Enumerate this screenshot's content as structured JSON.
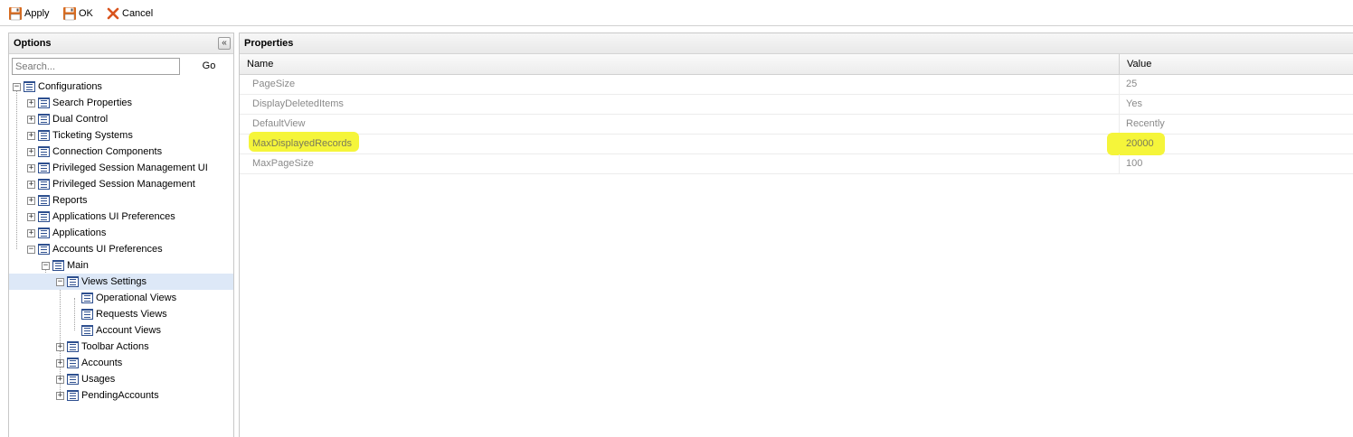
{
  "toolbar": {
    "apply_label": "Apply",
    "ok_label": "OK",
    "cancel_label": "Cancel"
  },
  "options_panel": {
    "title": "Options",
    "collapse_glyph": "«",
    "search_placeholder": "Search...",
    "go_label": "Go",
    "tree": [
      {
        "label": "Configurations",
        "expander": "−"
      },
      {
        "label": "Search Properties",
        "expander": "+"
      },
      {
        "label": "Dual Control",
        "expander": "+"
      },
      {
        "label": "Ticketing Systems",
        "expander": "+"
      },
      {
        "label": "Connection Components",
        "expander": "+"
      },
      {
        "label": "Privileged Session Management UI",
        "expander": "+"
      },
      {
        "label": "Privileged Session Management",
        "expander": "+"
      },
      {
        "label": "Reports",
        "expander": "+"
      },
      {
        "label": "Applications UI Preferences",
        "expander": "+"
      },
      {
        "label": "Applications",
        "expander": "+"
      },
      {
        "label": "Accounts UI Preferences",
        "expander": "−"
      },
      {
        "label": "Main",
        "expander": "−"
      },
      {
        "label": "Views Settings",
        "expander": "−",
        "selected": true
      },
      {
        "label": "Operational Views",
        "expander": ""
      },
      {
        "label": "Requests Views",
        "expander": ""
      },
      {
        "label": "Account Views",
        "expander": ""
      },
      {
        "label": "Toolbar Actions",
        "expander": "+"
      },
      {
        "label": "Accounts",
        "expander": "+"
      },
      {
        "label": "Usages",
        "expander": "+"
      },
      {
        "label": "PendingAccounts",
        "expander": "+"
      }
    ]
  },
  "properties_panel": {
    "title": "Properties",
    "columns": {
      "name": "Name",
      "value": "Value"
    },
    "rows": [
      {
        "name": "PageSize",
        "value": "25",
        "highlighted": false
      },
      {
        "name": "DisplayDeletedItems",
        "value": "Yes",
        "highlighted": false
      },
      {
        "name": "DefaultView",
        "value": "Recently",
        "highlighted": false
      },
      {
        "name": "MaxDisplayedRecords",
        "value": "20000",
        "highlighted": true
      },
      {
        "name": "MaxPageSize",
        "value": "100",
        "highlighted": false
      }
    ]
  },
  "colors": {
    "highlight": "#f5f53a",
    "selected_row": "#dde8f7",
    "cancel_icon": "#d9541e",
    "save_icon": "#d76b1f"
  }
}
